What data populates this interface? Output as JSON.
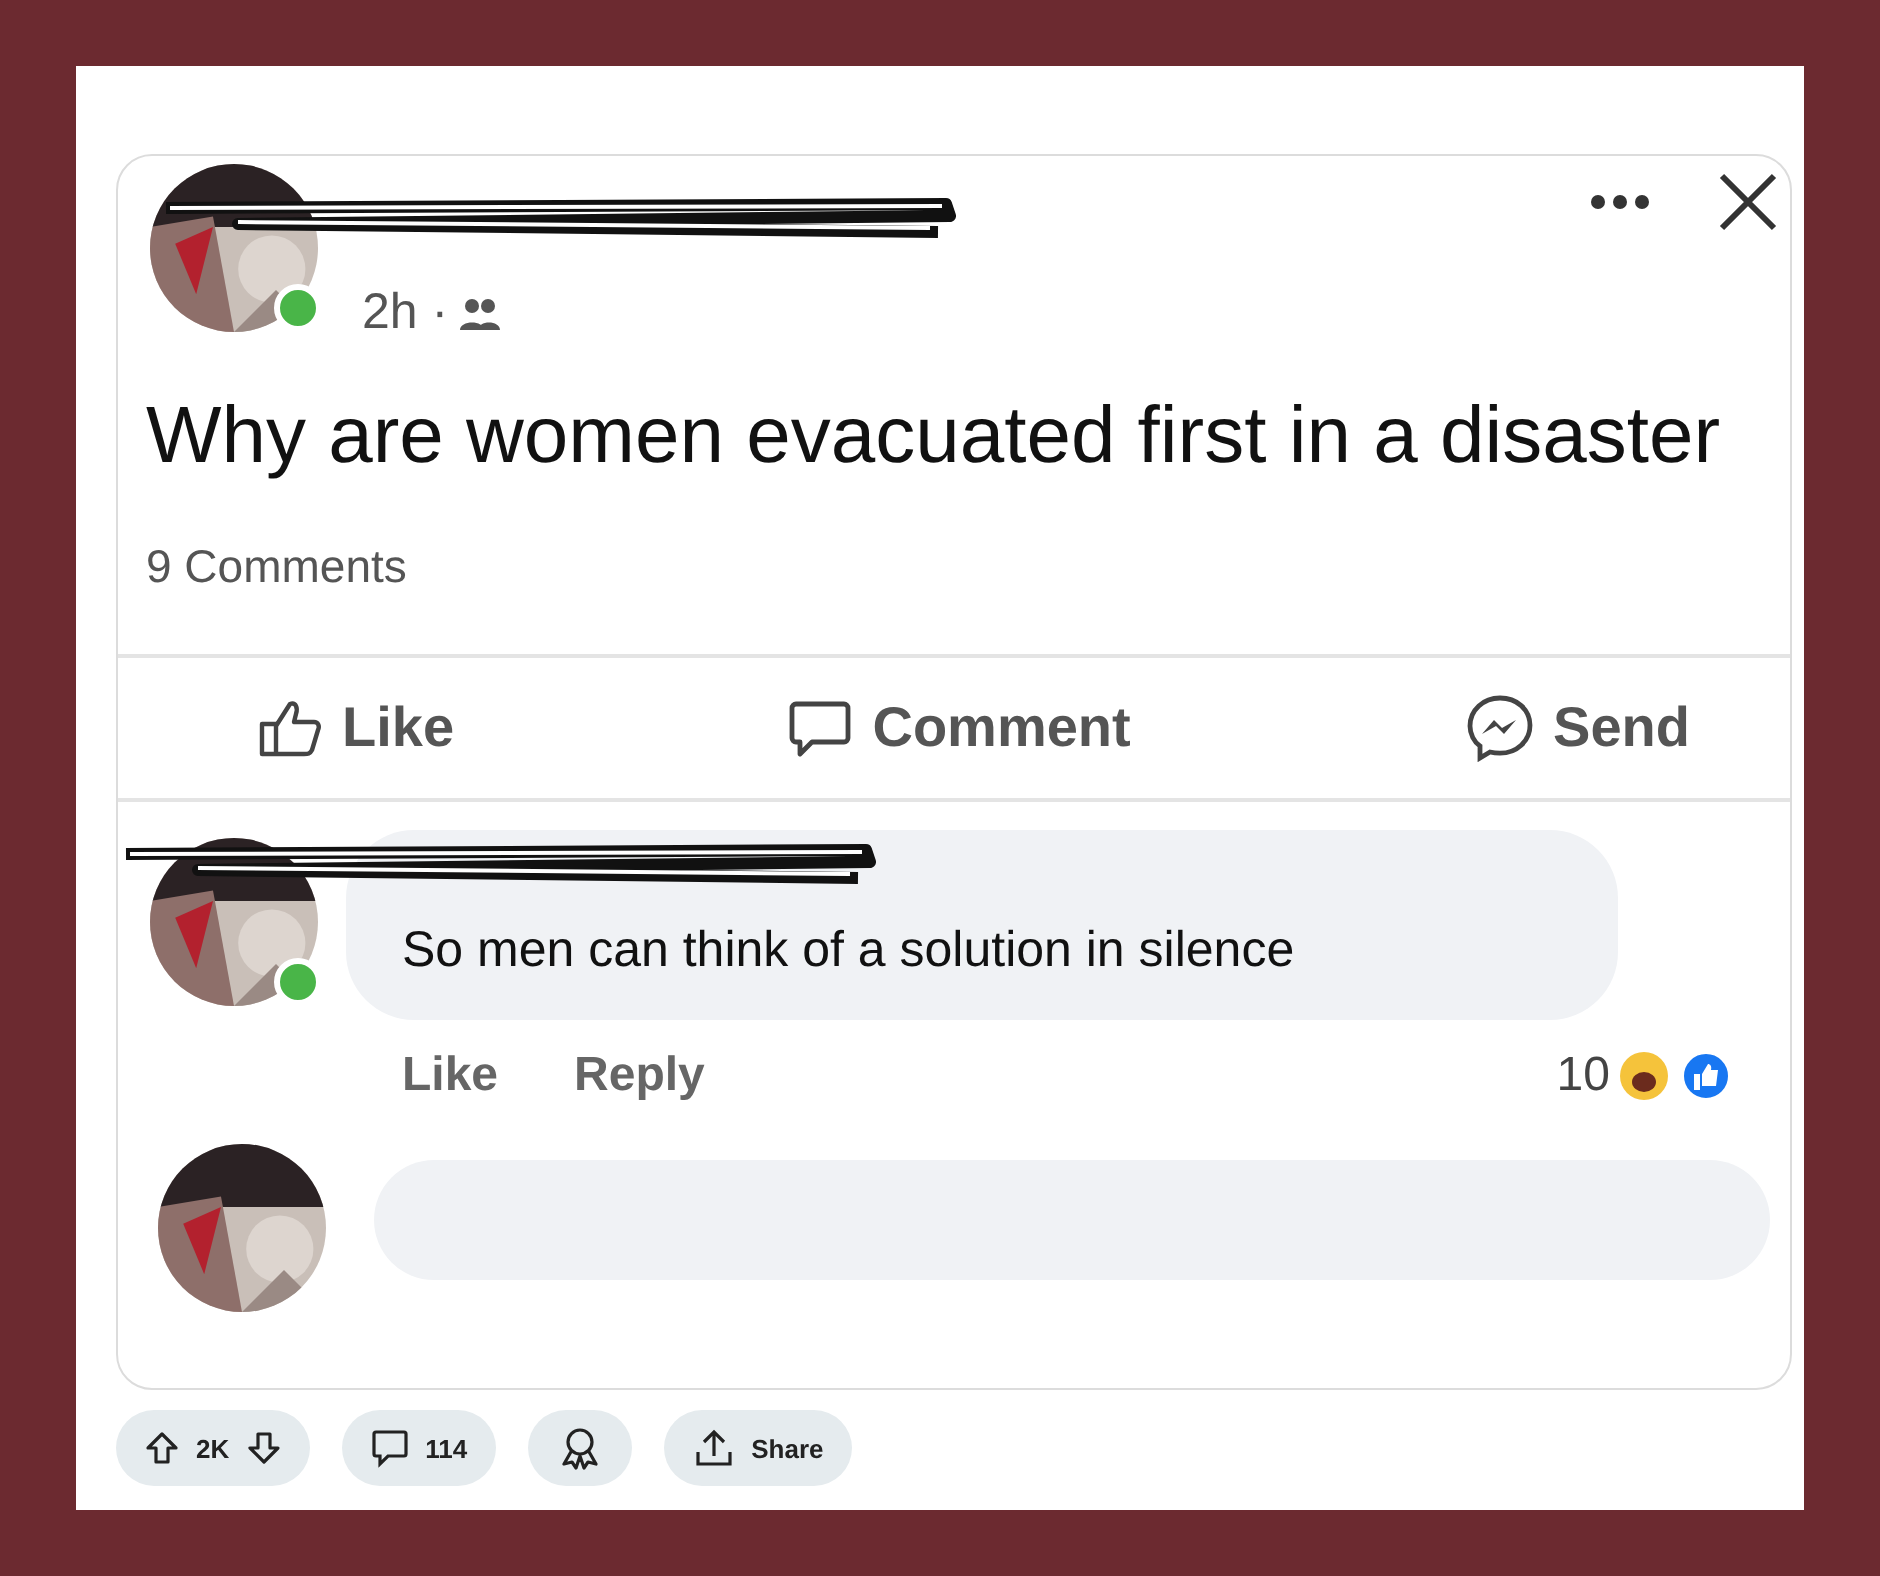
{
  "post": {
    "time": "2h ·",
    "title": "Why are women evacuated first in a disaster",
    "comment_count": "9 Comments",
    "actions": [
      {
        "kind": "like",
        "label": "Like"
      },
      {
        "kind": "comment",
        "label": "Comment"
      },
      {
        "kind": "send",
        "label": "Send"
      }
    ]
  },
  "comment": {
    "text": "So men can think of a solution in silence",
    "actions": [
      "Like",
      "Reply"
    ],
    "reaction_count": "10"
  },
  "footer": {
    "score": "2K",
    "comments": "114",
    "share": "Share"
  }
}
